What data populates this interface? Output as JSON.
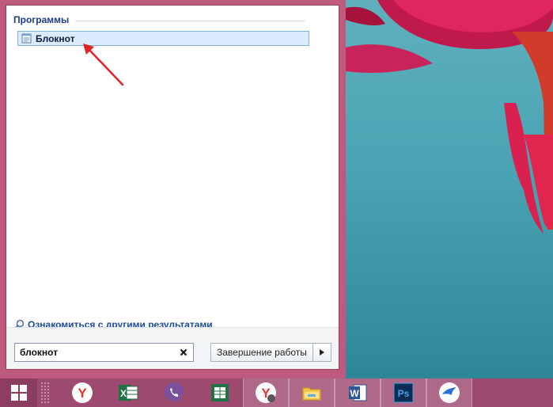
{
  "start_menu": {
    "section_title": "Программы",
    "result_item": {
      "label": "Блокнот",
      "icon": "notepad-icon"
    },
    "more_results_label": "Ознакомиться с другими результатами",
    "search": {
      "value": "блокнот",
      "placeholder": ""
    },
    "shutdown_label": "Завершение работы"
  },
  "taskbar": {
    "apps": [
      {
        "name": "yandex-browser",
        "icon": "Y",
        "color": "#e8322f"
      },
      {
        "name": "excel",
        "icon": "X",
        "color": "#1f7244"
      },
      {
        "name": "viber",
        "icon": "viber",
        "color": "#7b519d"
      },
      {
        "name": "excel-2",
        "icon": "X",
        "color": "#207245"
      },
      {
        "name": "yandex-browser-alt",
        "icon": "Y",
        "color": "#e8322f"
      },
      {
        "name": "file-explorer",
        "icon": "folder",
        "color": "#f4c542"
      },
      {
        "name": "word",
        "icon": "W",
        "color": "#2b5797"
      },
      {
        "name": "photoshop",
        "icon": "Ps",
        "color": "#0a2d56"
      },
      {
        "name": "bird-app",
        "icon": "bird",
        "color": "#2a6fd6"
      }
    ]
  },
  "colors": {
    "accent": "#1e3a8a",
    "highlight": "#dcebfb",
    "taskbar": "#9e4a6f",
    "annotation_arrow": "#e02424"
  }
}
